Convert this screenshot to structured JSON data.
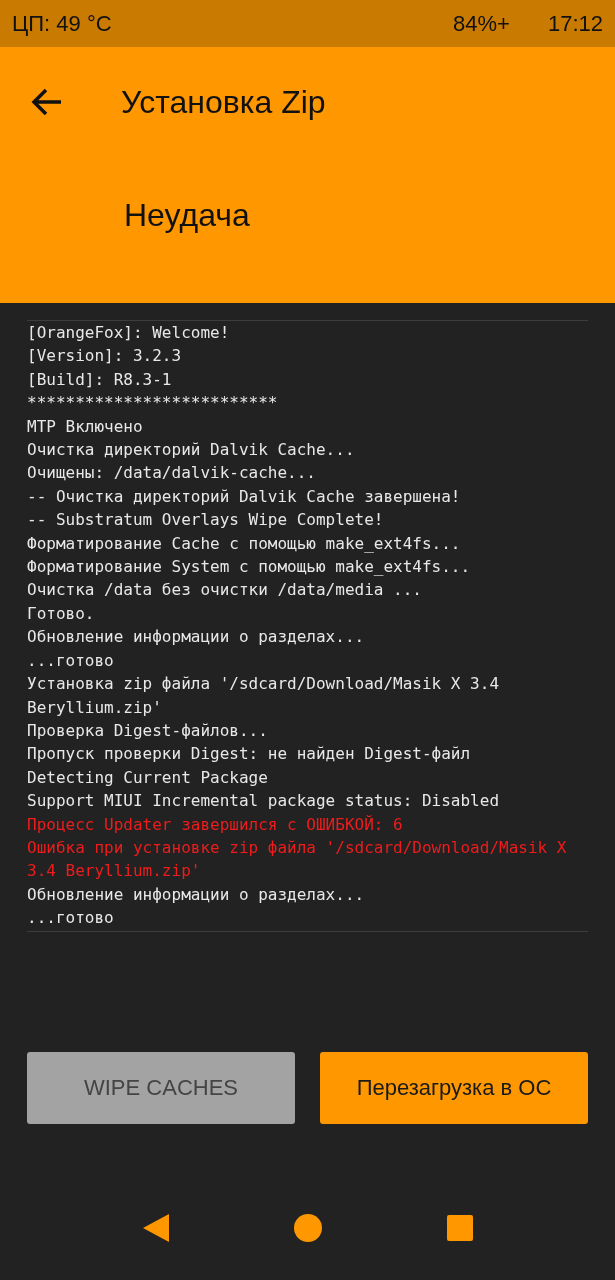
{
  "status_bar": {
    "cpu": "ЦП: 49 °C",
    "battery": "84%+",
    "time": "17:12"
  },
  "header": {
    "title": "Установка Zip",
    "status": "Неудача"
  },
  "log": [
    {
      "text": "[OrangeFox]: Welcome!",
      "kind": "normal"
    },
    {
      "text": "[Version]: 3.2.3",
      "kind": "normal"
    },
    {
      "text": "[Build]: R8.3-1",
      "kind": "normal"
    },
    {
      "text": "**************************",
      "kind": "normal"
    },
    {
      "text": "MTP Включено",
      "kind": "normal"
    },
    {
      "text": "Очистка директорий Dalvik Cache...",
      "kind": "normal"
    },
    {
      "text": "Очищены: /data/dalvik-cache...",
      "kind": "normal"
    },
    {
      "text": "-- Очистка директорий Dalvik Cache завершена!",
      "kind": "normal"
    },
    {
      "text": "-- Substratum Overlays Wipe Complete!",
      "kind": "normal"
    },
    {
      "text": "Форматирование Cache с помощью make_ext4fs...",
      "kind": "normal"
    },
    {
      "text": "Форматирование System с помощью make_ext4fs...",
      "kind": "normal"
    },
    {
      "text": "Очистка /data без очистки /data/media ...",
      "kind": "normal"
    },
    {
      "text": "Готово.",
      "kind": "normal"
    },
    {
      "text": "Обновление информации о разделах...",
      "kind": "normal"
    },
    {
      "text": "...готово",
      "kind": "normal"
    },
    {
      "text": "Установка zip файла '/sdcard/Download/Masik X 3.4",
      "kind": "normal"
    },
    {
      "text": "Beryllium.zip'",
      "kind": "normal"
    },
    {
      "text": "Проверка Digest-файлов...",
      "kind": "normal"
    },
    {
      "text": "Пропуск проверки Digest: не найден Digest-файл",
      "kind": "normal"
    },
    {
      "text": "Detecting Current Package",
      "kind": "normal"
    },
    {
      "text": "Support MIUI Incremental package status: Disabled",
      "kind": "normal"
    },
    {
      "text": "Процесс Updater завершился с ОШИБКОЙ: 6",
      "kind": "error"
    },
    {
      "text": "Ошибка при установке zip файла '/sdcard/Download/Masik X",
      "kind": "error"
    },
    {
      "text": "3.4 Beryllium.zip'",
      "kind": "error"
    },
    {
      "text": "Обновление информации о разделах...",
      "kind": "normal"
    },
    {
      "text": "...готово",
      "kind": "normal"
    }
  ],
  "buttons": [
    {
      "label": "WIPE CACHES",
      "kind": "secondary"
    },
    {
      "label": "Перезагрузка в ОС",
      "kind": "primary"
    }
  ]
}
